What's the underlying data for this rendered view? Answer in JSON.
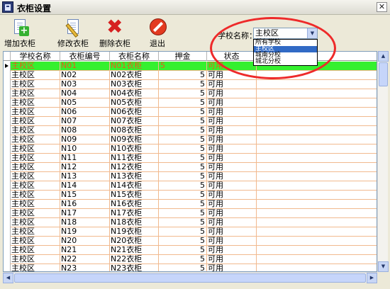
{
  "window": {
    "title": "衣柜设置",
    "close_glyph": "✕"
  },
  "toolbar": {
    "add_label": "增加衣柜",
    "edit_label": "修改衣柜",
    "delete_label": "删除衣柜",
    "exit_label": "退出",
    "add_icon": "add-document-icon",
    "edit_icon": "edit-document-icon",
    "delete_icon": "delete-x-icon",
    "exit_icon": "exit-stop-icon"
  },
  "filter": {
    "school_label": "学校名称：",
    "school_selected": "主校区",
    "school_options": [
      "所有学校",
      "主校区",
      "城南分校",
      "城北分校"
    ],
    "highlighted_option_index": 1
  },
  "grid": {
    "columns": [
      "学校名称",
      "衣柜编号",
      "衣柜名称",
      "押金",
      "状态",
      ""
    ],
    "rows": [
      [
        "主校区",
        "N01",
        "N01衣柜",
        "5",
        "可用"
      ],
      [
        "主校区",
        "N02",
        "N02衣柜",
        "5",
        "可用"
      ],
      [
        "主校区",
        "N03",
        "N03衣柜",
        "5",
        "可用"
      ],
      [
        "主校区",
        "N04",
        "N04衣柜",
        "5",
        "可用"
      ],
      [
        "主校区",
        "N05",
        "N05衣柜",
        "5",
        "可用"
      ],
      [
        "主校区",
        "N06",
        "N06衣柜",
        "5",
        "可用"
      ],
      [
        "主校区",
        "N07",
        "N07衣柜",
        "5",
        "可用"
      ],
      [
        "主校区",
        "N08",
        "N08衣柜",
        "5",
        "可用"
      ],
      [
        "主校区",
        "N09",
        "N09衣柜",
        "5",
        "可用"
      ],
      [
        "主校区",
        "N10",
        "N10衣柜",
        "5",
        "可用"
      ],
      [
        "主校区",
        "N11",
        "N11衣柜",
        "5",
        "可用"
      ],
      [
        "主校区",
        "N12",
        "N12衣柜",
        "5",
        "可用"
      ],
      [
        "主校区",
        "N13",
        "N13衣柜",
        "5",
        "可用"
      ],
      [
        "主校区",
        "N14",
        "N14衣柜",
        "5",
        "可用"
      ],
      [
        "主校区",
        "N15",
        "N15衣柜",
        "5",
        "可用"
      ],
      [
        "主校区",
        "N16",
        "N16衣柜",
        "5",
        "可用"
      ],
      [
        "主校区",
        "N17",
        "N17衣柜",
        "5",
        "可用"
      ],
      [
        "主校区",
        "N18",
        "N18衣柜",
        "5",
        "可用"
      ],
      [
        "主校区",
        "N19",
        "N19衣柜",
        "5",
        "可用"
      ],
      [
        "主校区",
        "N20",
        "N20衣柜",
        "5",
        "可用"
      ],
      [
        "主校区",
        "N21",
        "N21衣柜",
        "5",
        "可用"
      ],
      [
        "主校区",
        "N22",
        "N22衣柜",
        "5",
        "可用"
      ],
      [
        "主校区",
        "N23",
        "N23衣柜",
        "5",
        "可用"
      ]
    ],
    "selected_row_index": 0
  },
  "colors": {
    "selected_row_bg": "#35f02f",
    "selected_row_text": "#e95a19",
    "grid_line": "#f1b98e",
    "annotation_ellipse": "#ee2a2a",
    "dropdown_highlight": "#316ac5"
  }
}
